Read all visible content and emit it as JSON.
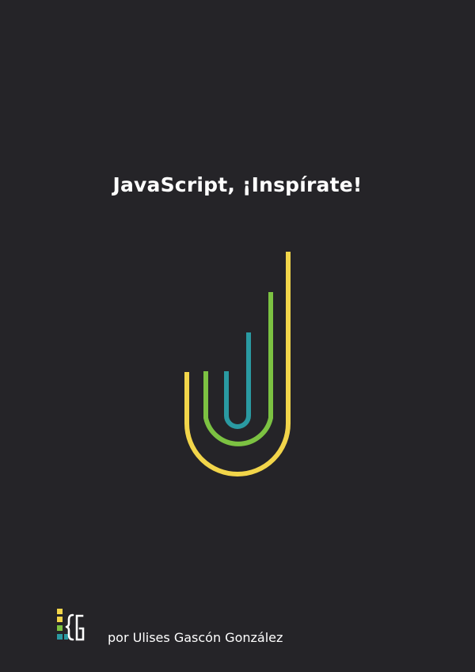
{
  "cover": {
    "title": "JavaScript, ¡Inspírate!",
    "author_line": "por Ulises Gascón González",
    "background_color": "#252428"
  },
  "logo": {
    "icon": "nested-j-arcs-icon",
    "colors": {
      "outer": "#f2d54a",
      "middle": "#7cc242",
      "inner": "#2a9aa2"
    }
  },
  "publisher": {
    "icon": "bracket-blocks-logo-icon",
    "colors": {
      "yellow": "#f2d54a",
      "green": "#7cc242",
      "teal": "#2a9aa2",
      "white": "#ffffff"
    }
  }
}
